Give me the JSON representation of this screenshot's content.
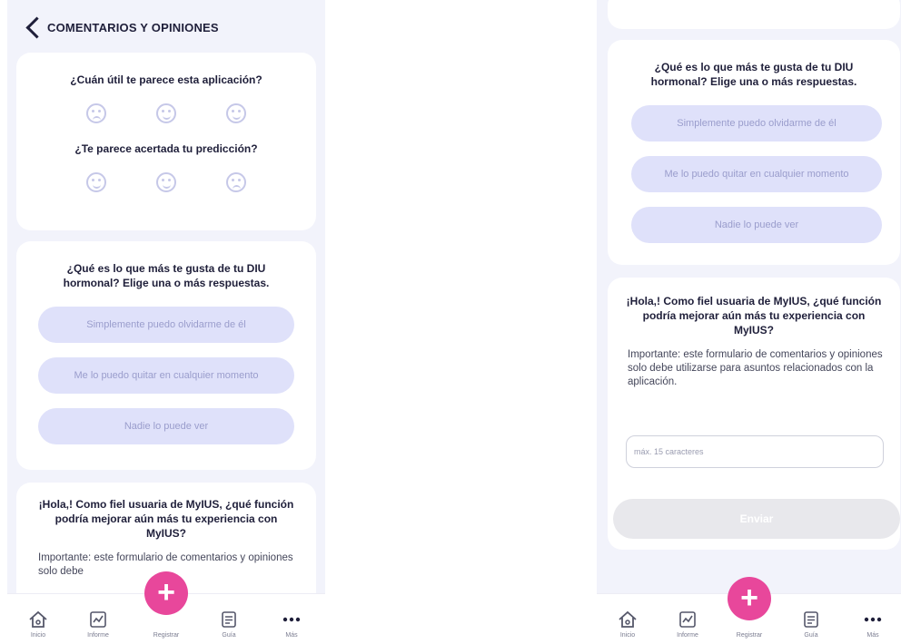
{
  "left": {
    "header_title": "COMENTARIOS Y OPINIONES",
    "q1": "¿Cuán útil te parece esta aplicación?",
    "q2": "¿Te parece acertada tu predicción?",
    "q3": "¿Qué es lo que más te gusta de tu DIU hormonal? Elige una o más respuestas.",
    "options": [
      "Simplemente puedo olvidarme de él",
      "Me lo puedo quitar en cualquier momento",
      "Nadie lo puede ver"
    ],
    "q4": "¡Hola,! Como fiel usuaria de MyIUS, ¿qué función podría mejorar aún más tu experiencia con MyIUS?",
    "important_text": "Importante: este formulario de comentarios y opiniones solo debe"
  },
  "right": {
    "q3": "¿Qué es lo que más te gusta de tu DIU hormonal? Elige una o más respuestas.",
    "options": [
      "Simplemente puedo olvidarme de él",
      "Me lo puedo quitar en cualquier momento",
      "Nadie lo puede ver"
    ],
    "q4": "¡Hola,! Como fiel usuaria de MyIUS, ¿qué función podría mejorar aún más tu experiencia con MyIUS?",
    "important_text": "Importante: este formulario de comentarios y opiniones solo debe utilizarse para asuntos relacionados con la aplicación.",
    "input_placeholder": "máx. 15 caracteres",
    "submit_label": "Enviar"
  },
  "tabbar": {
    "home": "Inicio",
    "report": "Informe",
    "register": "Registrar",
    "guide": "Guía",
    "more": "Más"
  },
  "colors": {
    "accent_pink": "#e8479b",
    "pill_bg": "#dfe1fa",
    "pill_text": "#9a9dcc",
    "page_bg": "#f2f3fb"
  }
}
